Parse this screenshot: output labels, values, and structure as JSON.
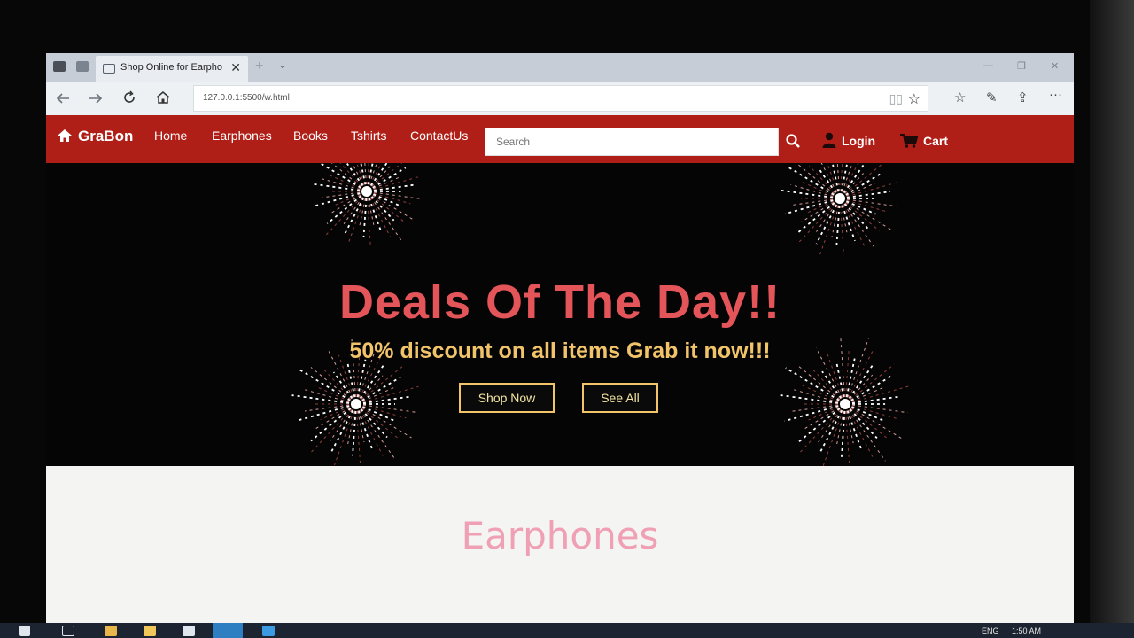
{
  "browser": {
    "tab_title": "Shop Online for Earpho",
    "tab_close": "✕",
    "new_tab": "+",
    "tab_list": "⌄",
    "url": "127.0.0.1:5500/w.html",
    "window_controls": [
      "—",
      "❐",
      "✕"
    ],
    "nav_icons": [
      "back-arrow-icon",
      "forward-arrow-icon",
      "refresh-icon",
      "home-icon"
    ],
    "toolbar_icons": [
      "favorites-icon",
      "pen-icon",
      "share-icon",
      "more-icon"
    ]
  },
  "site": {
    "brand": "GraBon",
    "menu": [
      "Home",
      "Earphones",
      "Books",
      "Tshirts",
      "ContactUs"
    ],
    "search_placeholder": "Search",
    "login": "Login",
    "cart": "Cart"
  },
  "hero": {
    "title": "Deals Of The Day!!",
    "subtitle": "50% discount on all items Grab it now!!!",
    "buttons": [
      "Shop Now",
      "See All"
    ]
  },
  "section": {
    "title": "Earphones",
    "subtitle": ""
  },
  "taskbar": {
    "language": "ENG",
    "time": "1:50 AM"
  },
  "colors": {
    "nav_bg": "#b01f17",
    "hero_title": "#e4555a",
    "hero_sub": "#f2c46a",
    "section_title": "#f0a0b5"
  }
}
